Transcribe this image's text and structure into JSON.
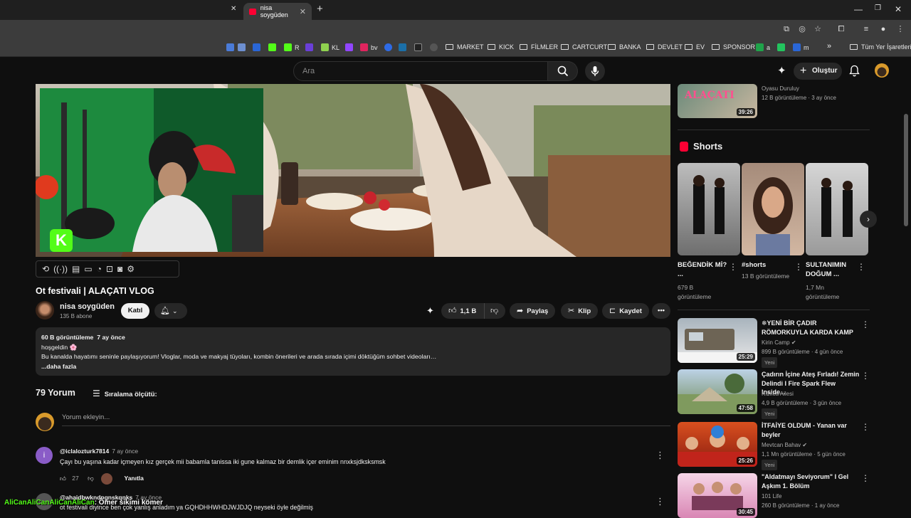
{
  "browser": {
    "active_tab_title": "nisa soygüden",
    "bookmarks": [
      "R",
      "KL",
      "bv",
      "MARKET",
      "KICK",
      "FİLMLER",
      "CARTCURT",
      "BANKA",
      "DEVLET",
      "EV",
      "SPONSOR",
      "a",
      "m"
    ],
    "all_bookmarks_label": "Tüm Yer İşaretleri"
  },
  "masthead": {
    "search_placeholder": "Ara",
    "create_label": "Oluştur"
  },
  "video": {
    "title": "Ot festivali | ALAÇATI VLOG",
    "channel_name": "nisa soygüden",
    "subscribers": "135 B abone",
    "join_label": "Katıl",
    "likes": "1,1 B",
    "share_label": "Paylaş",
    "clip_label": "Klip",
    "save_label": "Kaydet",
    "description": {
      "views": "60 B görüntüleme",
      "date": "7 ay önce",
      "line1": "hoşgeldin 🌸",
      "line2": "Bu kanalda hayatımı seninle paylaşıyorum! Vloglar, moda ve makyaj tüyoları, kombin önerileri ve arada sırada içimi döktüğüm sohbet videoları…",
      "more": "...daha fazla"
    }
  },
  "comments": {
    "count_label": "79 Yorum",
    "sort_label": "Sıralama ölçütü:",
    "input_placeholder": "Yorum ekleyin...",
    "items": [
      {
        "avatar_letter": "i",
        "author": "@iclalozturk7814",
        "time": "7 ay önce",
        "text": "Çayı bu yaşına kadar içmeyen kız gerçek mii babamla tanissa iki gune kalmaz bir demlik içer eminim nnxksjdksksmsk",
        "likes": "27",
        "reply_label": "Yanıtla"
      },
      {
        "author": "@ahaidbwkndpgnskqnks",
        "time": "7 ay önce",
        "text": "ot festivali diyince ben çok yanlış anladım ya GQHDHHWHDJWJDJQ neyseki öyle değilmiş"
      }
    ]
  },
  "sidebar": {
    "top_item": {
      "channel": "Oyasu Duruluy",
      "meta": "12 B görüntüleme · 3 ay önce",
      "duration": "39:26",
      "thumb_text": "ALAÇATI"
    },
    "shorts_title": "Shorts",
    "shorts": [
      {
        "title": "BEĞENDİK Mİ? ...",
        "views": "679 B görüntüleme"
      },
      {
        "title": "#shorts",
        "views": "13 B görüntüleme"
      },
      {
        "title": "SULTANIMIN DOĞUM ...",
        "views": "1,7 Mn görüntüleme"
      }
    ],
    "videos": [
      {
        "title": "❄YENİ BİR ÇADIR RÖMORKUYLA KARDA KAMP",
        "channel": "Kirin Camp",
        "meta": "899 B görüntüleme · 4 gün önce",
        "badge": "Yeni",
        "duration": "25:29"
      },
      {
        "title": "Çadırın İçine Ateş Fırladı! Zemin Delindi I Fire Spark Flew Inside...",
        "channel": "Kızılca Ailesi",
        "meta": "4,9 B görüntüleme · 3 gün önce",
        "badge": "Yeni",
        "duration": "47:58"
      },
      {
        "title": "İTFAİYE OLDUM - Yanan var beyler",
        "channel": "Mevtcan Bahav",
        "meta": "1,1 Mn görüntüleme · 5 gün önce",
        "badge": "Yeni",
        "duration": "25:26"
      },
      {
        "title": "\"Aldatmayı Seviyorum\" I Gel Aşkım 1. Bölüm",
        "channel": "101 Life",
        "meta": "260 B görüntüleme · 1 ay önce",
        "duration": "30:45"
      }
    ]
  },
  "stream_overlay": {
    "user": "AliCanAliCanAliCanAliCan",
    "message": ": Ömer sikimi kömer"
  }
}
